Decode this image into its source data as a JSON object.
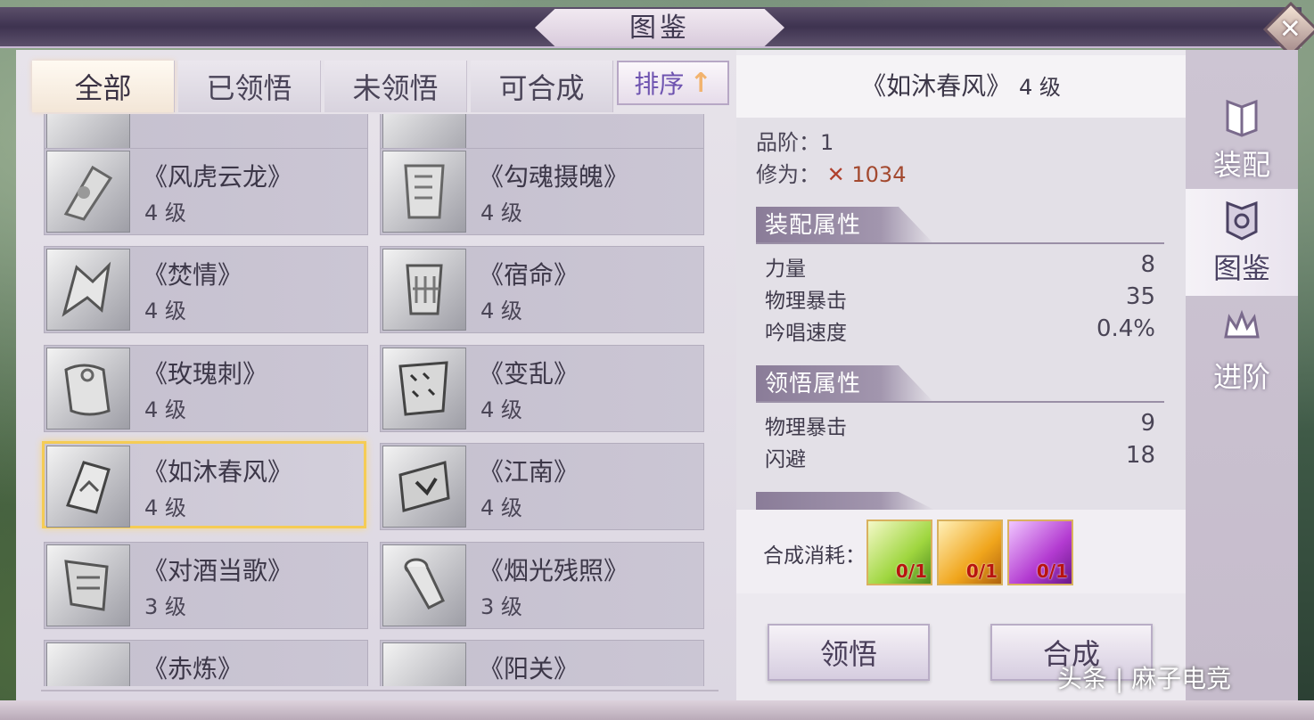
{
  "window": {
    "title": "图鉴",
    "close_symbol": "✕"
  },
  "tabs": [
    {
      "label": "全部",
      "active": true
    },
    {
      "label": "已领悟",
      "active": false
    },
    {
      "label": "未领悟",
      "active": false
    },
    {
      "label": "可合成",
      "active": false
    }
  ],
  "sort": {
    "label": "排序",
    "arrow": "↑"
  },
  "cards": [
    {
      "name": "《风虎云龙》",
      "level": "4 级"
    },
    {
      "name": "《勾魂摄魄》",
      "level": "4 级"
    },
    {
      "name": "《焚情》",
      "level": "4 级"
    },
    {
      "name": "《宿命》",
      "level": "4 级"
    },
    {
      "name": "《玫瑰刺》",
      "level": "4 级"
    },
    {
      "name": "《变乱》",
      "level": "4 级"
    },
    {
      "name": "《如沐春风》",
      "level": "4 级",
      "selected": true
    },
    {
      "name": "《江南》",
      "level": "4 级"
    },
    {
      "name": "《对酒当歌》",
      "level": "3 级"
    },
    {
      "name": "《烟光残照》",
      "level": "3 级"
    },
    {
      "name": "《赤炼》",
      "level": ""
    },
    {
      "name": "《阳关》",
      "level": ""
    }
  ],
  "detail": {
    "title": "《如沐春风》",
    "level": "4 级",
    "grade_label": "品阶：",
    "grade_value": "1",
    "cultivation_label": "修为：",
    "cultivation_value": "1034",
    "equip_section": "装配属性",
    "equip_attrs": [
      {
        "name": "力量",
        "value": "8"
      },
      {
        "name": "物理暴击",
        "value": "35"
      },
      {
        "name": "吟唱速度",
        "value": "0.4%"
      }
    ],
    "comprehend_section": "领悟属性",
    "comprehend_attrs": [
      {
        "name": "物理暴击",
        "value": "9"
      },
      {
        "name": "闪避",
        "value": "18"
      }
    ],
    "cost_label": "合成消耗：",
    "cost_items": [
      {
        "count": "0/1",
        "color": "#9fd63f"
      },
      {
        "count": "0/1",
        "color": "#f0a51c"
      },
      {
        "count": "0/1",
        "color": "#b33bd1"
      }
    ],
    "comprehend_button": "领悟",
    "synthesize_button": "合成"
  },
  "side_tabs": [
    {
      "label": "装配",
      "icon": "book-icon",
      "active": false
    },
    {
      "label": "图鉴",
      "icon": "shield-book-icon",
      "active": true
    },
    {
      "label": "进阶",
      "icon": "crown-icon",
      "active": false
    }
  ],
  "watermark": "头条 | 麻子电竞"
}
